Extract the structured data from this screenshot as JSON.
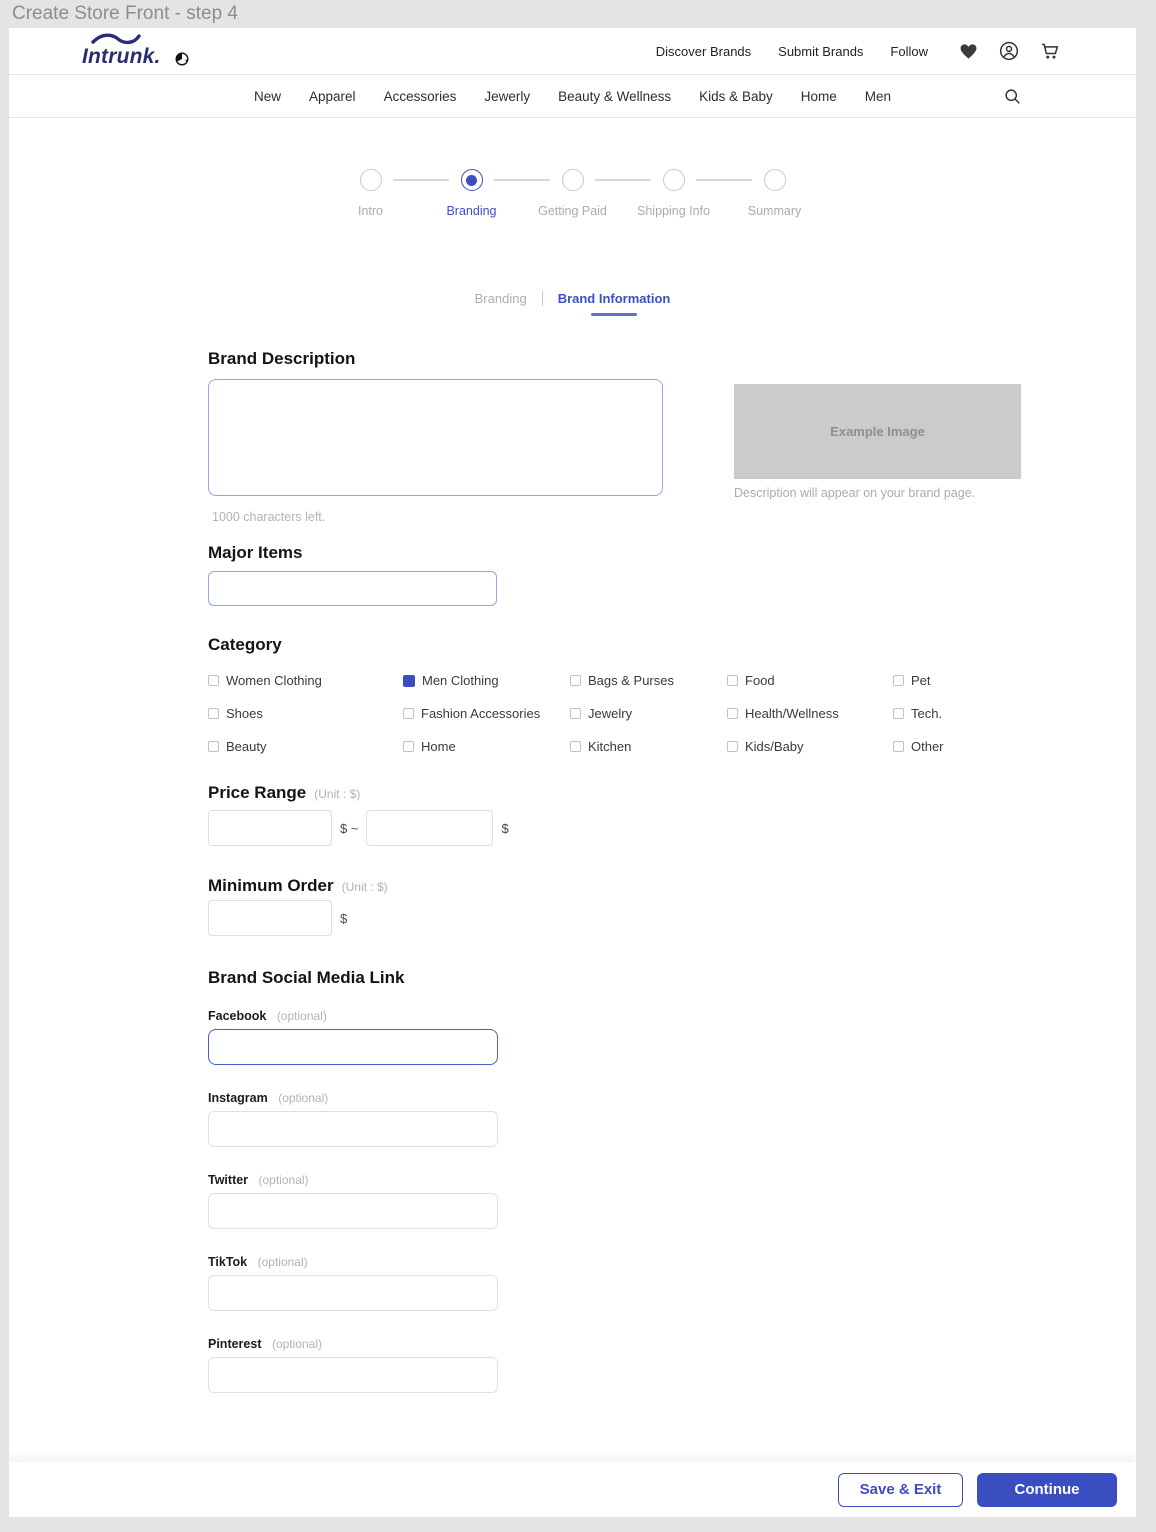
{
  "window": {
    "title": "Create Store Front - step 4"
  },
  "header": {
    "brand": "Intrunk.",
    "links": [
      "Discover Brands",
      "Submit Brands",
      "Follow"
    ],
    "icons": [
      "globe-icon",
      "heart-icon",
      "account-icon",
      "cart-icon"
    ]
  },
  "nav": {
    "items": [
      "New",
      "Apparel",
      "Accessories",
      "Jewerly",
      "Beauty & Wellness",
      "Kids & Baby",
      "Home",
      "Men"
    ],
    "icons": [
      "search-icon"
    ]
  },
  "stepper": {
    "steps": [
      {
        "label": "Intro",
        "active": false
      },
      {
        "label": "Branding",
        "active": true
      },
      {
        "label": "Getting Paid",
        "active": false
      },
      {
        "label": "Shipping Info",
        "active": false
      },
      {
        "label": "Summary",
        "active": false
      }
    ]
  },
  "tabs": {
    "items": [
      {
        "label": "Branding",
        "active": false
      },
      {
        "label": "Brand Information",
        "active": true
      }
    ]
  },
  "brand_description": {
    "heading": "Brand Description",
    "value": "",
    "hint": "1000 characters left.",
    "example_image_label": "Example Image",
    "example_caption": "Description will appear on your brand page."
  },
  "major_items": {
    "heading": "Major Items",
    "value": ""
  },
  "category": {
    "heading": "Category",
    "options": [
      {
        "label": "Women Clothing",
        "checked": false
      },
      {
        "label": "Men Clothing",
        "checked": true
      },
      {
        "label": "Bags & Purses",
        "checked": false
      },
      {
        "label": "Food",
        "checked": false
      },
      {
        "label": "Pet",
        "checked": false
      },
      {
        "label": "Shoes",
        "checked": false
      },
      {
        "label": "Fashion Accessories",
        "checked": false
      },
      {
        "label": "Jewelry",
        "checked": false
      },
      {
        "label": "Health/Wellness",
        "checked": false
      },
      {
        "label": "Tech.",
        "checked": false
      },
      {
        "label": "Beauty",
        "checked": false
      },
      {
        "label": "Home",
        "checked": false
      },
      {
        "label": "Kitchen",
        "checked": false
      },
      {
        "label": "Kids/Baby",
        "checked": false
      },
      {
        "label": "Other",
        "checked": false
      }
    ]
  },
  "price_range": {
    "heading": "Price Range",
    "unit_note": "(Unit : $)",
    "min_value": "",
    "max_value": "",
    "between_text": "$ ~",
    "suffix": "$"
  },
  "minimum_order": {
    "heading": "Minimum Order",
    "unit_note": "(Unit : $)",
    "value": "",
    "suffix": "$"
  },
  "social": {
    "heading": "Brand Social Media Link",
    "optional_note": "(optional)",
    "fields": [
      {
        "label": "Facebook",
        "value": "",
        "focused": true
      },
      {
        "label": "Instagram",
        "value": "",
        "focused": false
      },
      {
        "label": "Twitter",
        "value": "",
        "focused": false
      },
      {
        "label": "TikTok",
        "value": "",
        "focused": false
      },
      {
        "label": "Pinterest",
        "value": "",
        "focused": false
      }
    ]
  },
  "footer": {
    "save_exit_label": "Save & Exit",
    "continue_label": "Continue"
  },
  "colors": {
    "accent": "#3B4EC1",
    "logo_navy": "#2A2D72"
  }
}
